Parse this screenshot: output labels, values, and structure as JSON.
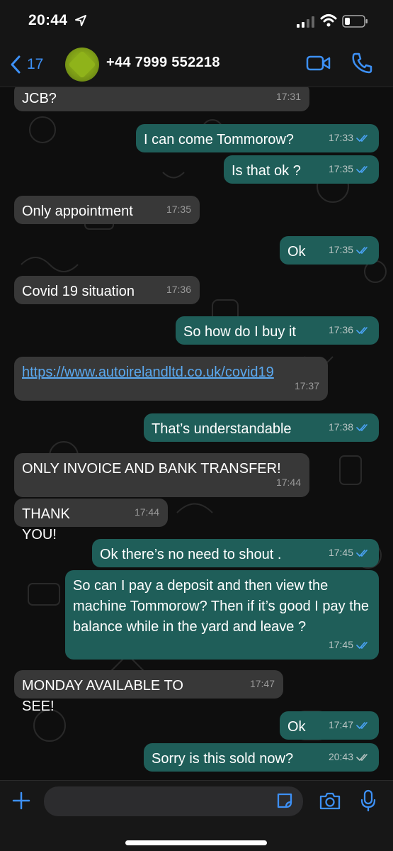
{
  "status_bar": {
    "time": "20:44"
  },
  "header": {
    "back_count": "17",
    "contact": "+44 7999 552218"
  },
  "colors": {
    "accent": "#3d90f5",
    "incoming_bubble": "#383838",
    "outgoing_bubble": "#1f5e59",
    "read_tick": "#4aa3f5"
  },
  "messages": [
    {
      "dir": "in",
      "text": "JCB?",
      "time": "17:31"
    },
    {
      "dir": "out",
      "text": "I can come Tommorow?",
      "time": "17:33",
      "status": "read"
    },
    {
      "dir": "out",
      "text": "Is that ok ?",
      "time": "17:35",
      "status": "read"
    },
    {
      "dir": "in",
      "text": "Only appointment",
      "time": "17:35"
    },
    {
      "dir": "out",
      "text": "Ok",
      "time": "17:35",
      "status": "read"
    },
    {
      "dir": "in",
      "text": "Covid 19 situation",
      "time": "17:36"
    },
    {
      "dir": "out",
      "text": "So how do I buy it",
      "time": "17:36",
      "status": "read"
    },
    {
      "dir": "in",
      "text": "https://www.autoirelandltd.co.uk/covid19",
      "time": "17:37",
      "link": true
    },
    {
      "dir": "out",
      "text": "That’s understandable",
      "time": "17:38",
      "status": "read"
    },
    {
      "dir": "in",
      "text": "ONLY INVOICE AND BANK TRANSFER!",
      "time": "17:44"
    },
    {
      "dir": "in",
      "text": "THANK YOU!",
      "time": "17:44"
    },
    {
      "dir": "out",
      "text": "Ok there’s no need to shout .",
      "time": "17:45",
      "status": "read"
    },
    {
      "dir": "out",
      "text": "So can I pay a deposit and then view the machine Tommorow? Then if it’s good I pay the balance while in the yard and leave ?",
      "time": "17:45",
      "status": "read"
    },
    {
      "dir": "in",
      "text": "MONDAY AVAILABLE TO SEE!",
      "time": "17:47"
    },
    {
      "dir": "out",
      "text": "Ok",
      "time": "17:47",
      "status": "read"
    },
    {
      "dir": "out",
      "text": "Sorry is this sold now?",
      "time": "20:43",
      "status": "delivered"
    }
  ],
  "composer": {
    "placeholder": ""
  }
}
